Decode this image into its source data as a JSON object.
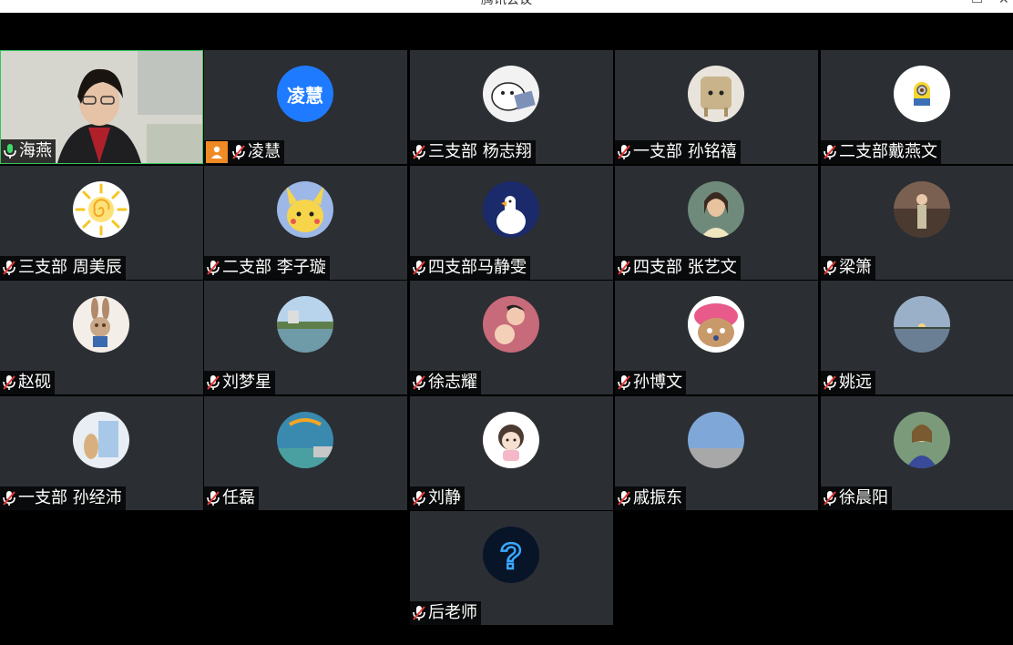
{
  "window": {
    "title": "腾讯会议"
  },
  "participants": [
    {
      "name": "海燕",
      "mic": "on",
      "avatar": "camera-video"
    },
    {
      "name": "凌慧",
      "mic": "muted",
      "avatar_text": "凌慧",
      "host": true
    },
    {
      "name": "三支部 杨志翔",
      "mic": "muted",
      "avatar": "cartoon-duck"
    },
    {
      "name": "一支部 孙铭禧",
      "mic": "muted",
      "avatar": "stool-character"
    },
    {
      "name": "二支部戴燕文",
      "mic": "muted",
      "avatar": "minion"
    },
    {
      "name": "三支部 周美辰",
      "mic": "muted",
      "avatar": "sun-swirl"
    },
    {
      "name": "二支部 李子璇",
      "mic": "muted",
      "avatar": "pikachu"
    },
    {
      "name": "四支部马静雯",
      "mic": "muted",
      "avatar": "white-goose"
    },
    {
      "name": "四支部 张艺文",
      "mic": "muted",
      "avatar": "portrait-woman"
    },
    {
      "name": "梁箫",
      "mic": "muted",
      "avatar": "figure-in-room"
    },
    {
      "name": "赵砚",
      "mic": "muted",
      "avatar": "bunny-character"
    },
    {
      "name": "刘梦星",
      "mic": "muted",
      "avatar": "lake-landscape"
    },
    {
      "name": "徐志耀",
      "mic": "muted",
      "avatar": "children-photo"
    },
    {
      "name": "孙博文",
      "mic": "muted",
      "avatar": "chopper"
    },
    {
      "name": "姚远",
      "mic": "muted",
      "avatar": "sunset-lake"
    },
    {
      "name": "一支部 孙经沛",
      "mic": "muted",
      "avatar": "cat-painting"
    },
    {
      "name": "任磊",
      "mic": "muted",
      "avatar": "paraglider"
    },
    {
      "name": "刘静",
      "mic": "muted",
      "avatar": "cartoon-girl"
    },
    {
      "name": "戚振东",
      "mic": "muted",
      "avatar": "sea-sky"
    },
    {
      "name": "徐晨阳",
      "mic": "muted",
      "avatar": "woman-photo"
    },
    {
      "name": "后老师",
      "mic": "muted",
      "avatar": "neon-question"
    }
  ],
  "colors": {
    "host_badge": "#f08a24",
    "self_border": "#37c45f",
    "tile_bg": "#2b2e33"
  }
}
